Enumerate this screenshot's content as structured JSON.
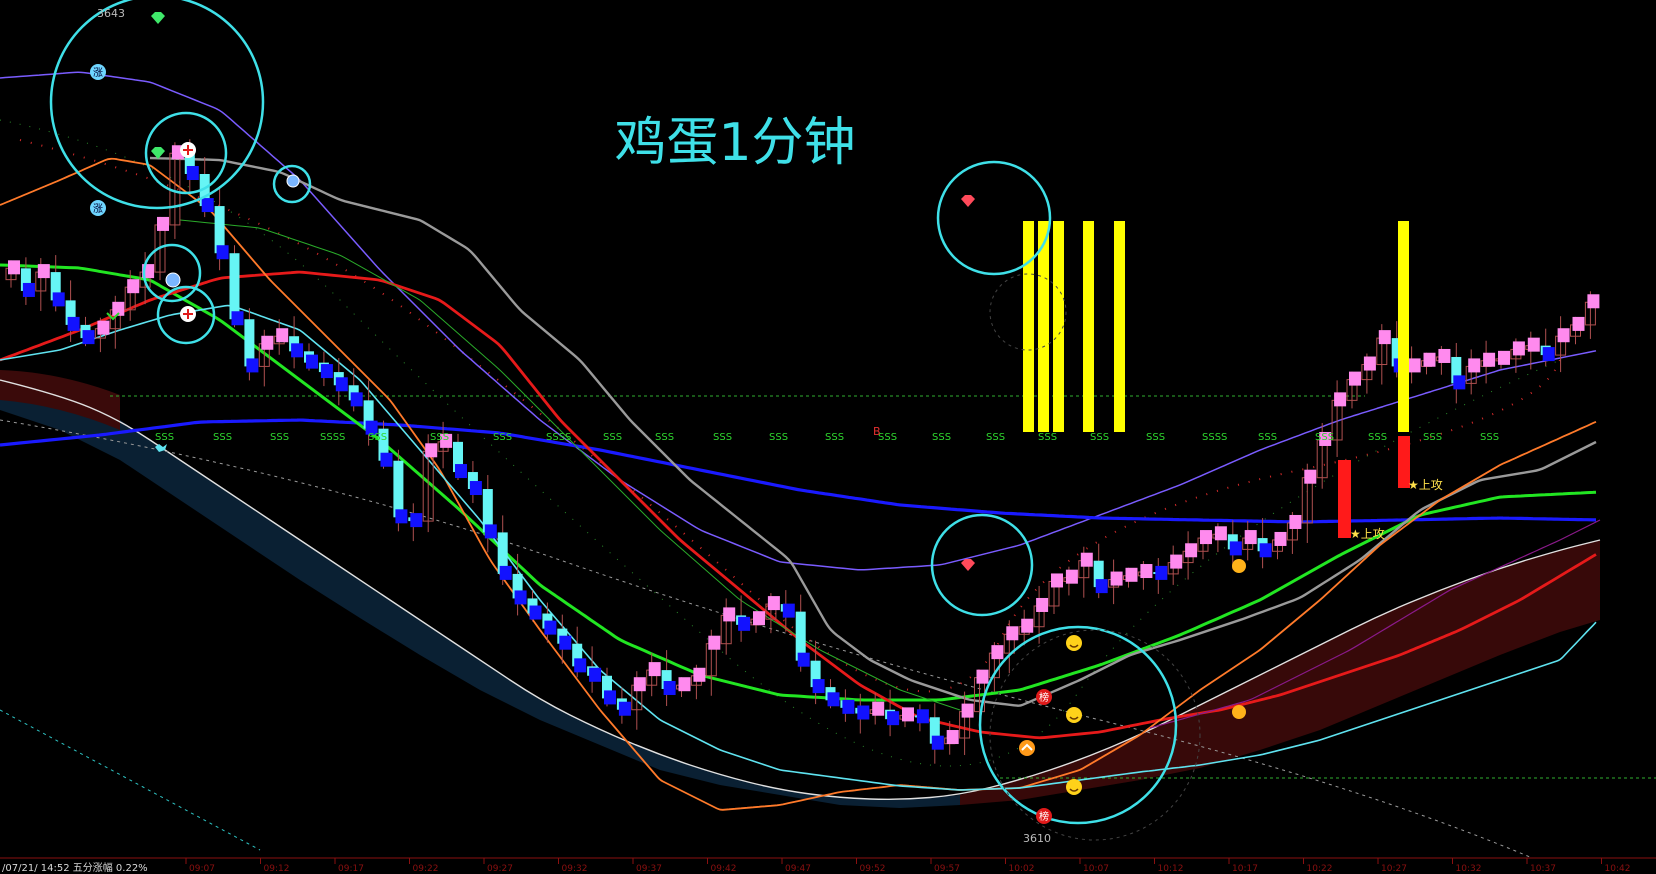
{
  "chart_data": {
    "type": "candlestick",
    "title": "鸡蛋1分钟",
    "labels": {
      "high_marker": "3643",
      "low_marker": "3610",
      "sss_marker": "SSS",
      "ssss_marker": "SSSS",
      "b_marker": "B",
      "zhang_badge": "涨",
      "bang_badge": "榜",
      "bottom_left_text": "/07/21/  14:52  五分涨幅 0.22%",
      "star_labels": [
        "★上攻",
        "★上攻"
      ]
    },
    "y_axis_range": [
      3606,
      3650
    ],
    "x_axis_ticks": [
      "09:07",
      "09:12",
      "09:17",
      "09:22",
      "09:27",
      "09:32",
      "09:37",
      "09:42",
      "09:47",
      "09:52",
      "09:57",
      "10:02",
      "10:07",
      "10:12",
      "10:17",
      "10:22",
      "10:27",
      "10:32",
      "10:37",
      "10:42"
    ],
    "candles_close": [
      3636.2,
      3635.0,
      3636.0,
      3634.5,
      3633.2,
      3632.5,
      3633.0,
      3634.0,
      3635.2,
      3636.0,
      3638.5,
      3642.3,
      3641.2,
      3639.5,
      3637.0,
      3633.5,
      3631.0,
      3632.2,
      3632.6,
      3631.8,
      3631.2,
      3630.7,
      3630.0,
      3629.2,
      3627.7,
      3626.0,
      3623.0,
      3622.8,
      3626.5,
      3627.0,
      3625.4,
      3624.5,
      3622.2,
      3620.0,
      3618.7,
      3617.9,
      3617.1,
      3616.3,
      3615.1,
      3614.6,
      3613.4,
      3612.8,
      3614.1,
      3614.9,
      3613.9,
      3614.1,
      3614.6,
      3616.3,
      3617.8,
      3617.3,
      3617.6,
      3618.4,
      3618.0,
      3615.4,
      3614.0,
      3613.3,
      3612.9,
      3612.6,
      3612.8,
      3612.3,
      3612.5,
      3612.4,
      3611.0,
      3611.3,
      3612.7,
      3614.5,
      3615.8,
      3616.8,
      3617.2,
      3618.3,
      3619.6,
      3619.8,
      3620.7,
      3619.3,
      3619.7,
      3619.9,
      3620.1,
      3620.0,
      3620.6,
      3621.2,
      3621.9,
      3622.1,
      3621.3,
      3621.9,
      3621.2,
      3621.8,
      3622.7,
      3625.1,
      3627.1,
      3629.2,
      3630.3,
      3631.1,
      3632.5,
      3631.0,
      3631.0,
      3631.3,
      3631.5,
      3630.1,
      3631.0,
      3631.3,
      3631.4,
      3631.9,
      3632.1,
      3631.6,
      3632.6,
      3633.2,
      3634.4
    ],
    "series": [
      {
        "name": "MA-green",
        "color": "#22e622"
      },
      {
        "name": "MA-blue",
        "color": "#1a1aff"
      },
      {
        "name": "MA-red",
        "color": "#e61a1a"
      },
      {
        "name": "MA-gray",
        "color": "#9a9a9a"
      },
      {
        "name": "MA-violet",
        "color": "#7a5cff"
      },
      {
        "name": "MA-orange",
        "color": "#ff7a2a"
      },
      {
        "name": "MA-cyan",
        "color": "#5fe3f0"
      }
    ],
    "colors": {
      "up_body": "#ff8aee",
      "down_body": "#66f5f5",
      "wick": "#b05050",
      "signal_bar": "#ffff00",
      "red_bar": "#ff1a1a",
      "circle": "#3fe0e8",
      "title": "#3fe0e8"
    }
  }
}
